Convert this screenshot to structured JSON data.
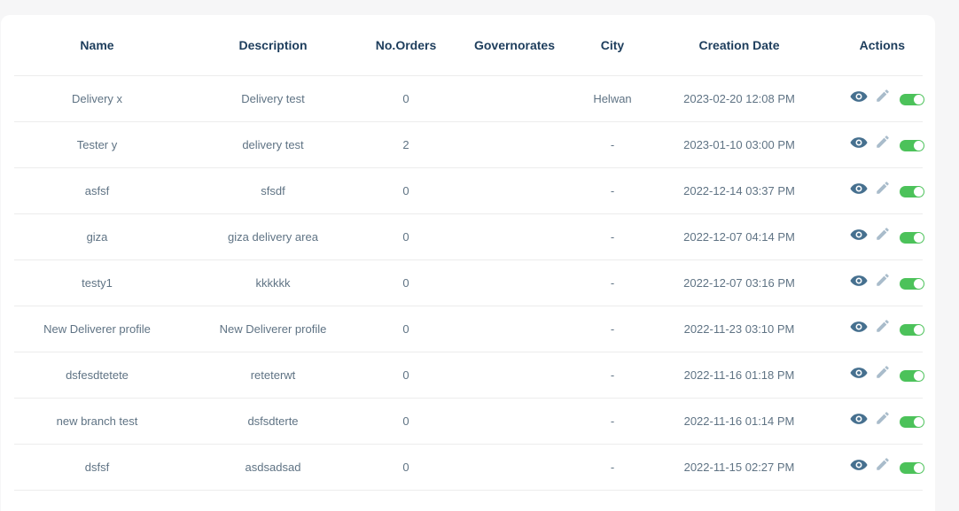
{
  "colors": {
    "toggle_on": "#4cc25a",
    "eye_icon": "#46708f",
    "pencil_icon": "#a9bccb",
    "header_text": "#1d3d5c",
    "cell_text": "#5f7384"
  },
  "table": {
    "headers": [
      "Name",
      "Description",
      "No.Orders",
      "Governorates",
      "City",
      "Creation Date",
      "Actions"
    ],
    "rows": [
      {
        "name": "Delivery x",
        "description": "Delivery test",
        "orders": "0",
        "governorates": "",
        "city": "Helwan",
        "date": "2023-02-20 12:08 PM",
        "active": true
      },
      {
        "name": "Tester y",
        "description": "delivery test",
        "orders": "2",
        "governorates": "",
        "city": "-",
        "date": "2023-01-10 03:00 PM",
        "active": true
      },
      {
        "name": "asfsf",
        "description": "sfsdf",
        "orders": "0",
        "governorates": "",
        "city": "-",
        "date": "2022-12-14 03:37 PM",
        "active": true
      },
      {
        "name": "giza",
        "description": "giza delivery area",
        "orders": "0",
        "governorates": "",
        "city": "-",
        "date": "2022-12-07 04:14 PM",
        "active": true
      },
      {
        "name": "testy1",
        "description": "kkkkkk",
        "orders": "0",
        "governorates": "",
        "city": "-",
        "date": "2022-12-07 03:16 PM",
        "active": true
      },
      {
        "name": "New Deliverer profile",
        "description": "New Deliverer profile",
        "orders": "0",
        "governorates": "",
        "city": "-",
        "date": "2022-11-23 03:10 PM",
        "active": true
      },
      {
        "name": "dsfesdtetete",
        "description": "reteterwt",
        "orders": "0",
        "governorates": "",
        "city": "-",
        "date": "2022-11-16 01:18 PM",
        "active": true
      },
      {
        "name": "new branch test",
        "description": "dsfsdterte",
        "orders": "0",
        "governorates": "",
        "city": "-",
        "date": "2022-11-16 01:14 PM",
        "active": true
      },
      {
        "name": "dsfsf",
        "description": "asdsadsad",
        "orders": "0",
        "governorates": "",
        "city": "-",
        "date": "2022-11-15 02:27 PM",
        "active": true
      }
    ],
    "action_icons": [
      "eye-icon",
      "pencil-icon",
      "toggle-switch"
    ]
  }
}
